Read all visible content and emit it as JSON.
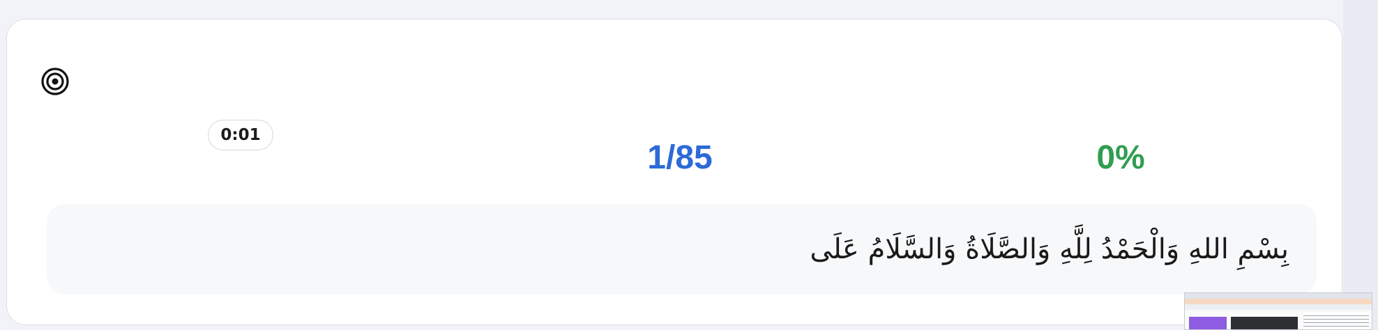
{
  "session": {
    "timer": "0:01",
    "progress": "1/85",
    "accuracy": "0%"
  },
  "passage": {
    "text": "بِسْمِ اللهِ وَالْحَمْدُ لِلَّهِ وَالصَّلَاةُ وَالسَّلَامُ عَلَى"
  },
  "icons": {
    "header": "target-icon"
  },
  "colors": {
    "progress": "#2d6ad7",
    "accuracy": "#2f9e51"
  }
}
